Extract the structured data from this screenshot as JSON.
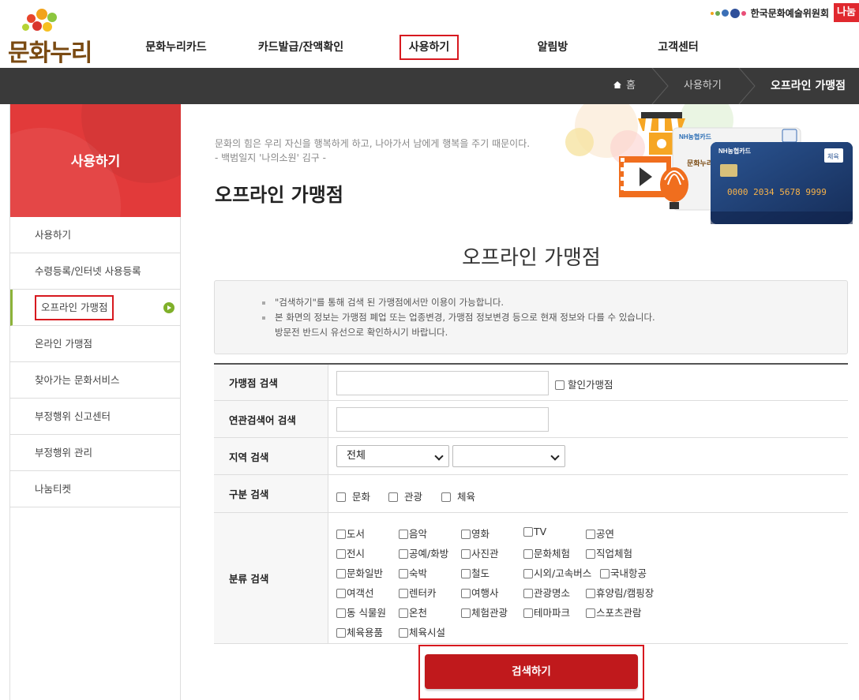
{
  "brand": {
    "logo_text": "문화누리",
    "council_name": "한국문화예술위원회",
    "nanum_badge": "나눔"
  },
  "gnb": [
    {
      "label": "문화누리카드",
      "active": false
    },
    {
      "label": "카드발급/잔액확인",
      "active": false
    },
    {
      "label": "사용하기",
      "active": true
    },
    {
      "label": "알림방",
      "active": false
    },
    {
      "label": "고객센터",
      "active": false
    }
  ],
  "breadcrumb": {
    "home": "홈",
    "level1": "사용하기",
    "current": "오프라인 가맹점"
  },
  "sidebar": {
    "title": "사용하기",
    "items": [
      {
        "label": "사용하기"
      },
      {
        "label": "수령등록/인터넷 사용등록"
      },
      {
        "label": "오프라인 가맹점",
        "active": true
      },
      {
        "label": "온라인 가맹점"
      },
      {
        "label": "찾아가는 문화서비스"
      },
      {
        "label": "부정행위 신고센터"
      },
      {
        "label": "부정행위 관리"
      },
      {
        "label": "나눔티켓"
      }
    ]
  },
  "hero": {
    "quote_line1": "문화의 힘은 우리 자신을 행복하게 하고, 나아가서 남에게 행복을 주기 때문이다.",
    "quote_line2": "- 백범일지 '나의소원' 김구 -",
    "page_title": "오프라인 가맹점",
    "card_brand": "NH농협카드",
    "card_number": "0000 2034 5678 9999",
    "card_tag": "체육",
    "card_small_text": "문화누리"
  },
  "section_title": "오프라인 가맹점",
  "notice": [
    "\"검색하기\"를 통해 검색 된 가맹점에서만 이용이 가능합니다.",
    "본 화면의 정보는 가맹점 폐업 또는 업종변경, 가맹점 정보변경 등으로 현재 정보와 다를 수 있습니다.",
    "방문전 반드시 유선으로 확인하시기 바랍니다."
  ],
  "search": {
    "store_label": "가맹점 검색",
    "store_value": "",
    "discount_label": "할인가맹점",
    "keyword_label": "연관검색어 검색",
    "keyword_value": "",
    "region_label": "지역 검색",
    "region_primary": "전체",
    "region_secondary": "",
    "type_label": "구분 검색",
    "types": [
      "문화",
      "관광",
      "체육"
    ],
    "category_label": "분류 검색",
    "categories": [
      [
        "도서",
        "음악",
        "영화",
        "TV",
        "공연"
      ],
      [
        "전시",
        "공예/화방",
        "사진관",
        "문화체험",
        "직업체험"
      ],
      [
        "문화일반",
        "숙박",
        "철도",
        "시외/고속버스",
        "국내항공"
      ],
      [
        "여객선",
        "렌터카",
        "여행사",
        "관광명소",
        "휴양림/캠핑장"
      ],
      [
        "동 식물원",
        "온천",
        "체험관광",
        "테마파크",
        "스포츠관람"
      ],
      [
        "체육용품",
        "체육시설"
      ]
    ],
    "button_label": "검색하기"
  },
  "colors": {
    "accent_red": "#c0191c",
    "highlight_red": "#d7191f",
    "sidebar_red": "#e23a3a",
    "crumb_bg": "#3a3a3a",
    "active_green": "#7fb02a"
  }
}
